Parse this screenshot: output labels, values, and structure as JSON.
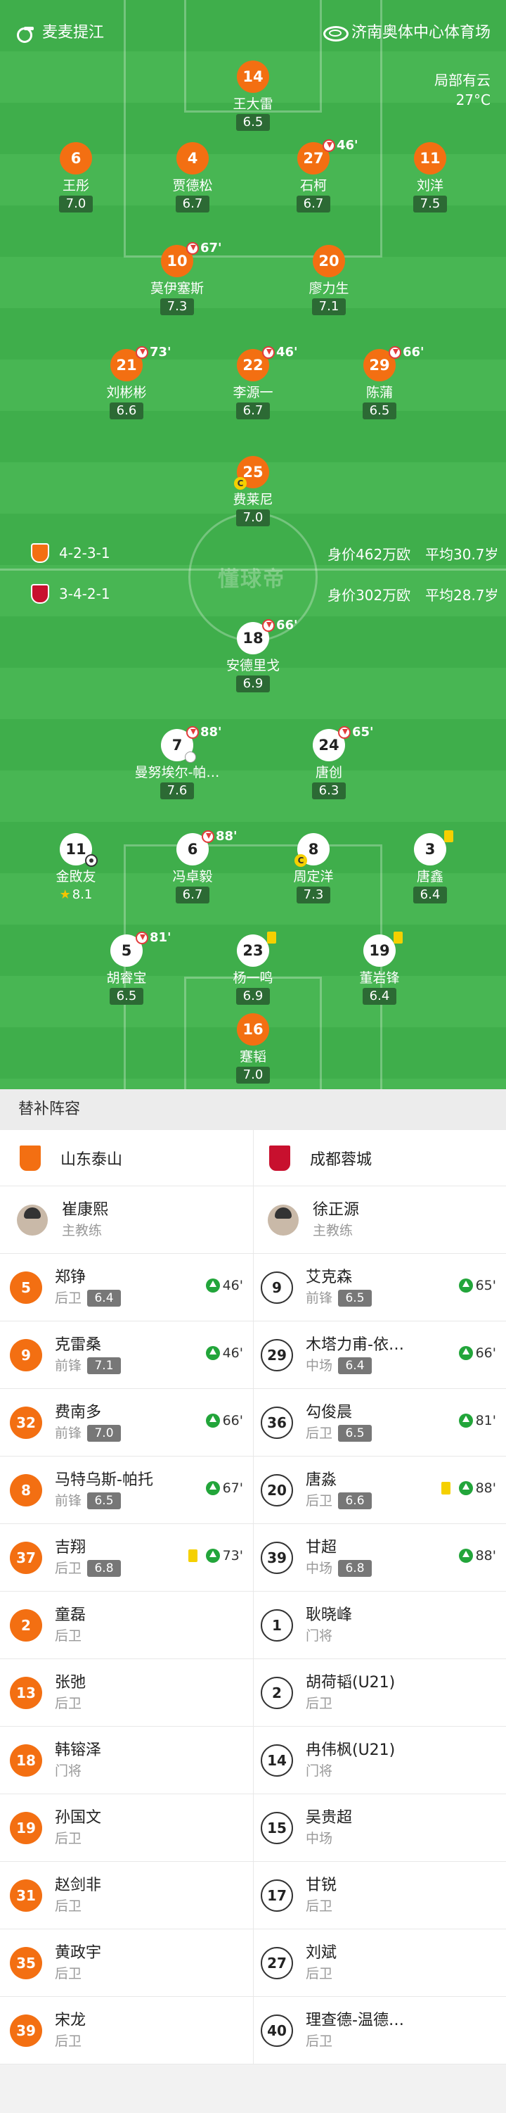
{
  "header": {
    "referee": "麦麦提江",
    "stadium": "济南奥体中心体育场",
    "weather": "局部有云",
    "temperature": "27°C"
  },
  "watermark": "懂球帝",
  "home": {
    "formation": "4-2-3-1",
    "value": "身价462万欧",
    "age": "平均30.7岁",
    "players": [
      {
        "num": "14",
        "name": "王大雷",
        "rating": "6.5"
      },
      {
        "num": "6",
        "name": "王彤",
        "rating": "7.0"
      },
      {
        "num": "4",
        "name": "贾德松",
        "rating": "6.7"
      },
      {
        "num": "27",
        "name": "石柯",
        "rating": "6.7",
        "sub": "46'"
      },
      {
        "num": "11",
        "name": "刘洋",
        "rating": "7.5"
      },
      {
        "num": "10",
        "name": "莫伊塞斯",
        "rating": "7.3",
        "sub": "67'"
      },
      {
        "num": "20",
        "name": "廖力生",
        "rating": "7.1"
      },
      {
        "num": "21",
        "name": "刘彬彬",
        "rating": "6.6",
        "sub": "73'"
      },
      {
        "num": "22",
        "name": "李源一",
        "rating": "6.7",
        "sub": "46'"
      },
      {
        "num": "29",
        "name": "陈蒲",
        "rating": "6.5",
        "sub": "66'"
      },
      {
        "num": "25",
        "name": "费莱尼",
        "rating": "7.0",
        "captain": "C"
      }
    ]
  },
  "away": {
    "formation": "3-4-2-1",
    "value": "身价302万欧",
    "age": "平均28.7岁",
    "players": [
      {
        "num": "18",
        "name": "安德里戈",
        "rating": "6.9",
        "sub": "66'"
      },
      {
        "num": "7",
        "name": "曼努埃尔-帕…",
        "rating": "7.6",
        "sub": "88'"
      },
      {
        "num": "24",
        "name": "唐创",
        "rating": "6.3",
        "sub": "65'"
      },
      {
        "num": "11",
        "name": "金敃友",
        "rating": "8.1"
      },
      {
        "num": "6",
        "name": "冯卓毅",
        "rating": "6.7",
        "sub": "88'"
      },
      {
        "num": "8",
        "name": "周定洋",
        "rating": "7.3",
        "captain": "C"
      },
      {
        "num": "3",
        "name": "唐鑫",
        "rating": "6.4"
      },
      {
        "num": "5",
        "name": "胡睿宝",
        "rating": "6.5",
        "sub": "81'"
      },
      {
        "num": "23",
        "name": "杨一鸣",
        "rating": "6.9"
      },
      {
        "num": "19",
        "name": "董岩锋",
        "rating": "6.4"
      },
      {
        "num": "16",
        "name": "蹇韬",
        "rating": "7.0"
      }
    ]
  },
  "subs": {
    "title": "替补阵容",
    "home_team": "山东泰山",
    "away_team": "成都蓉城",
    "home_coach": {
      "name": "崔康熙",
      "role": "主教练"
    },
    "away_coach": {
      "name": "徐正源",
      "role": "主教练"
    },
    "rows": [
      [
        {
          "num": "5",
          "name": "郑铮",
          "pos": "后卫",
          "rating": "6.4",
          "on": "46'"
        },
        {
          "num": "9",
          "name": "艾克森",
          "pos": "前锋",
          "rating": "6.5",
          "on": "65'"
        }
      ],
      [
        {
          "num": "9",
          "name": "克雷桑",
          "pos": "前锋",
          "rating": "7.1",
          "on": "46'"
        },
        {
          "num": "29",
          "name": "木塔力甫-依…",
          "pos": "中场",
          "rating": "6.4",
          "on": "66'"
        }
      ],
      [
        {
          "num": "32",
          "name": "费南多",
          "pos": "前锋",
          "rating": "7.0",
          "on": "66'"
        },
        {
          "num": "36",
          "name": "勾俊晨",
          "pos": "后卫",
          "rating": "6.5",
          "on": "81'"
        }
      ],
      [
        {
          "num": "8",
          "name": "马特乌斯-帕托",
          "pos": "前锋",
          "rating": "6.5",
          "on": "67'"
        },
        {
          "num": "20",
          "name": "唐淼",
          "pos": "后卫",
          "rating": "6.6",
          "on": "88'",
          "yellow": "yellow-card"
        }
      ],
      [
        {
          "num": "37",
          "name": "吉翔",
          "pos": "后卫",
          "rating": "6.8",
          "on": "73'",
          "yellow": "yellow-card"
        },
        {
          "num": "39",
          "name": "甘超",
          "pos": "中场",
          "rating": "6.8",
          "on": "88'"
        }
      ],
      [
        {
          "num": "2",
          "name": "童磊",
          "pos": "后卫"
        },
        {
          "num": "1",
          "name": "耿晓峰",
          "pos": "门将"
        }
      ],
      [
        {
          "num": "13",
          "name": "张弛",
          "pos": "后卫"
        },
        {
          "num": "2",
          "name": "胡荷韬(U21)",
          "pos": "后卫"
        }
      ],
      [
        {
          "num": "18",
          "name": "韩镕泽",
          "pos": "门将"
        },
        {
          "num": "14",
          "name": "冉伟枫(U21)",
          "pos": "门将"
        }
      ],
      [
        {
          "num": "19",
          "name": "孙国文",
          "pos": "后卫"
        },
        {
          "num": "15",
          "name": "吴贵超",
          "pos": "中场"
        }
      ],
      [
        {
          "num": "31",
          "name": "赵剑非",
          "pos": "后卫"
        },
        {
          "num": "17",
          "name": "甘锐",
          "pos": "后卫"
        }
      ],
      [
        {
          "num": "35",
          "name": "黄政宇",
          "pos": "后卫"
        },
        {
          "num": "27",
          "name": "刘斌",
          "pos": "后卫"
        }
      ],
      [
        {
          "num": "39",
          "name": "宋龙",
          "pos": "后卫"
        },
        {
          "num": "40",
          "name": "理查德-温德…",
          "pos": "后卫"
        }
      ]
    ]
  }
}
